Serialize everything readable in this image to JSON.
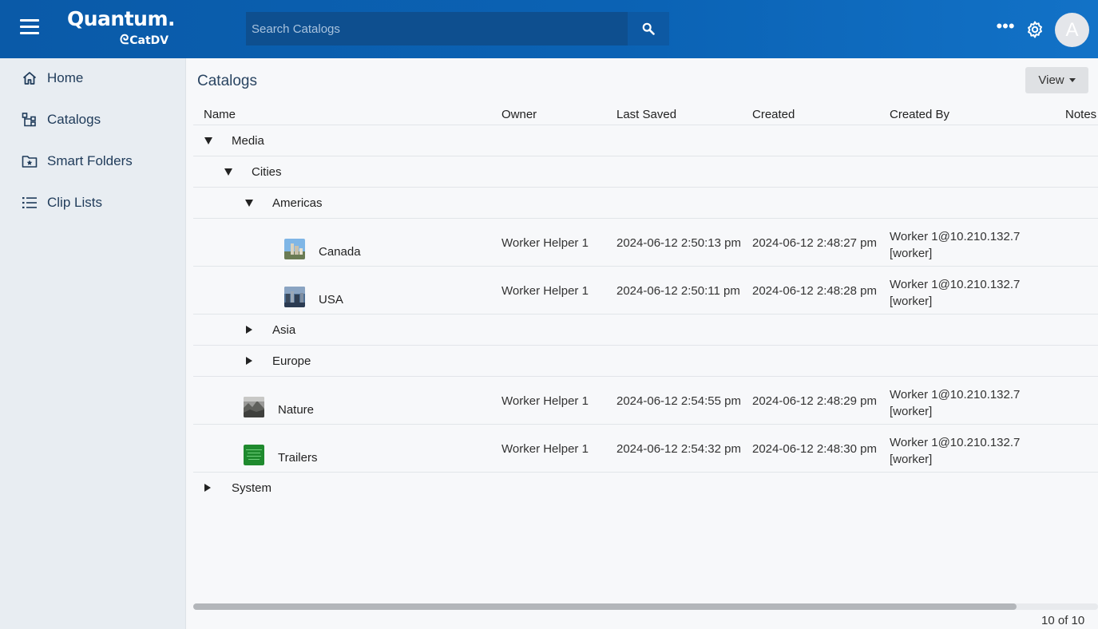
{
  "header": {
    "logo_main": "Quantum.",
    "logo_sub": "CatDV",
    "search_placeholder": "Search Catalogs",
    "avatar_letter": "A",
    "more_label": "•••"
  },
  "sidebar": {
    "items": [
      {
        "label": "Home",
        "icon": "home-icon"
      },
      {
        "label": "Catalogs",
        "icon": "catalogs-tree-icon"
      },
      {
        "label": "Smart Folders",
        "icon": "smart-folder-icon"
      },
      {
        "label": "Clip Lists",
        "icon": "list-icon"
      }
    ]
  },
  "main": {
    "title": "Catalogs",
    "view_label": "View"
  },
  "table": {
    "columns": [
      "Name",
      "Owner",
      "Last Saved",
      "Created",
      "Created By",
      "Notes"
    ],
    "rows": [
      {
        "name": "Media",
        "state": "expanded"
      },
      {
        "name": "Cities",
        "state": "expanded"
      },
      {
        "name": "Americas",
        "state": "expanded"
      },
      {
        "name": "Canada",
        "owner": "Worker Helper 1",
        "last_saved": "2024-06-12 2:50:13 pm",
        "created": "2024-06-12 2:48:27 pm",
        "created_by_1": "Worker 1@10.210.132.7",
        "created_by_2": "[worker]"
      },
      {
        "name": "USA",
        "owner": "Worker Helper 1",
        "last_saved": "2024-06-12 2:50:11 pm",
        "created": "2024-06-12 2:48:28 pm",
        "created_by_1": "Worker 1@10.210.132.7",
        "created_by_2": "[worker]"
      },
      {
        "name": "Asia",
        "state": "collapsed"
      },
      {
        "name": "Europe",
        "state": "collapsed"
      },
      {
        "name": "Nature",
        "owner": "Worker Helper 1",
        "last_saved": "2024-06-12 2:54:55 pm",
        "created": "2024-06-12 2:48:29 pm",
        "created_by_1": "Worker 1@10.210.132.7",
        "created_by_2": "[worker]"
      },
      {
        "name": "Trailers",
        "owner": "Worker Helper 1",
        "last_saved": "2024-06-12 2:54:32 pm",
        "created": "2024-06-12 2:48:30 pm",
        "created_by_1": "Worker 1@10.210.132.7",
        "created_by_2": "[worker]"
      },
      {
        "name": "System",
        "state": "collapsed"
      }
    ]
  },
  "footer": {
    "count": "10 of 10"
  },
  "colors": {
    "header_bg": "#0b63b5",
    "sidebar_bg": "#e8edf2",
    "accent_text": "#1f3b5a"
  }
}
